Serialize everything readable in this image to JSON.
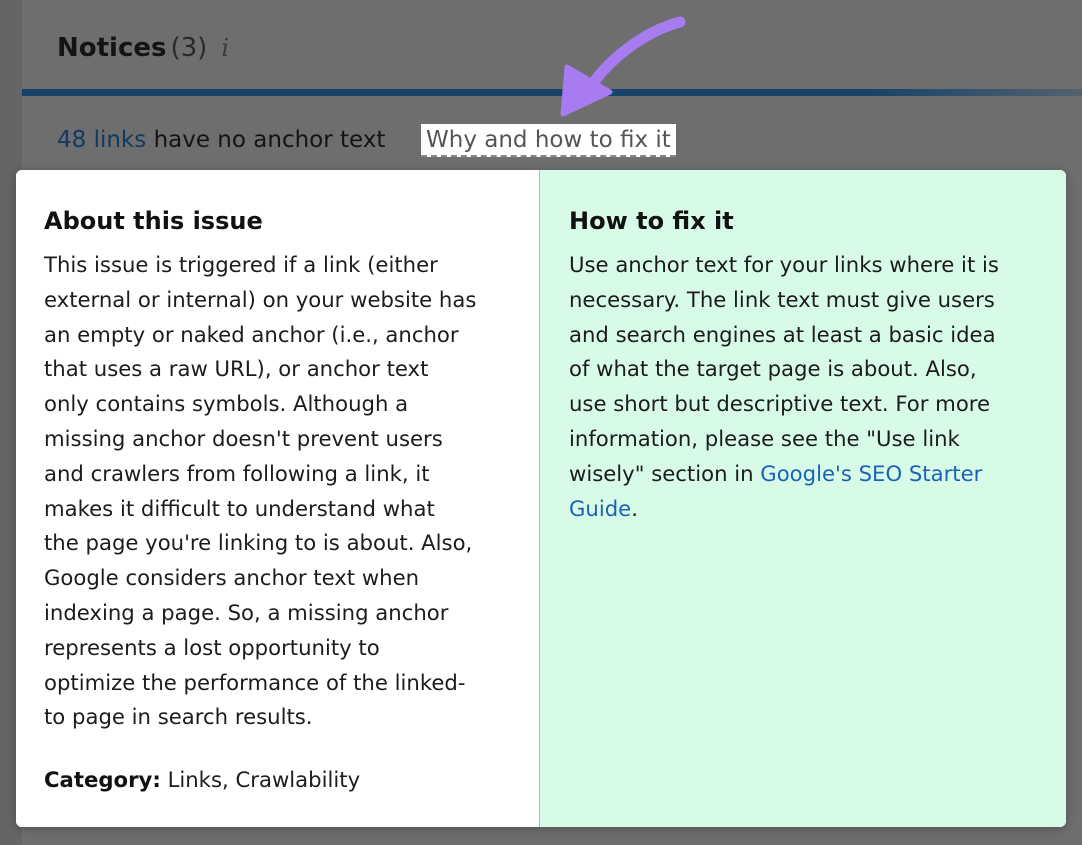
{
  "header": {
    "title": "Notices",
    "count": "(3)",
    "info_glyph": "i"
  },
  "issue": {
    "link_text": "48 links",
    "rest_text": "have no anchor text",
    "fix_link": "Why and how to fix it"
  },
  "about": {
    "title": "About this issue",
    "lines": [
      "This issue is triggered if a link (either",
      "external or internal) on your website has",
      "an empty or naked anchor (i.e., anchor",
      "that uses a raw URL), or anchor text",
      "only contains symbols. Although a",
      "missing anchor doesn't prevent users",
      "and crawlers from following a link, it",
      "makes it difficult to understand what",
      "the page you're linking to is about. Also,",
      "Google considers anchor text when",
      "indexing a page. So, a missing anchor",
      "represents a lost opportunity to",
      "optimize the performance of the linked-",
      "to page in search results."
    ],
    "category_label": "Category:",
    "category_value": "Links, Crawlability"
  },
  "fix": {
    "title": "How to fix it",
    "lines": [
      "Use anchor text for your links where it is",
      "necessary. The link text must give users",
      "and search engines at least a basic idea",
      "of what the target page is about. Also,",
      "use short but descriptive text. For more",
      "information, please see the \"Use link"
    ],
    "line7_text": "wisely\" section in ",
    "link_part1": "Google's SEO Starter",
    "link_part2": "Guide",
    "end_punct": "."
  },
  "colors": {
    "accent_bar": "#17436a",
    "arrow": "#a67cf0",
    "fix_panel_bg": "#d8fbe8",
    "link": "#1a62b5"
  }
}
